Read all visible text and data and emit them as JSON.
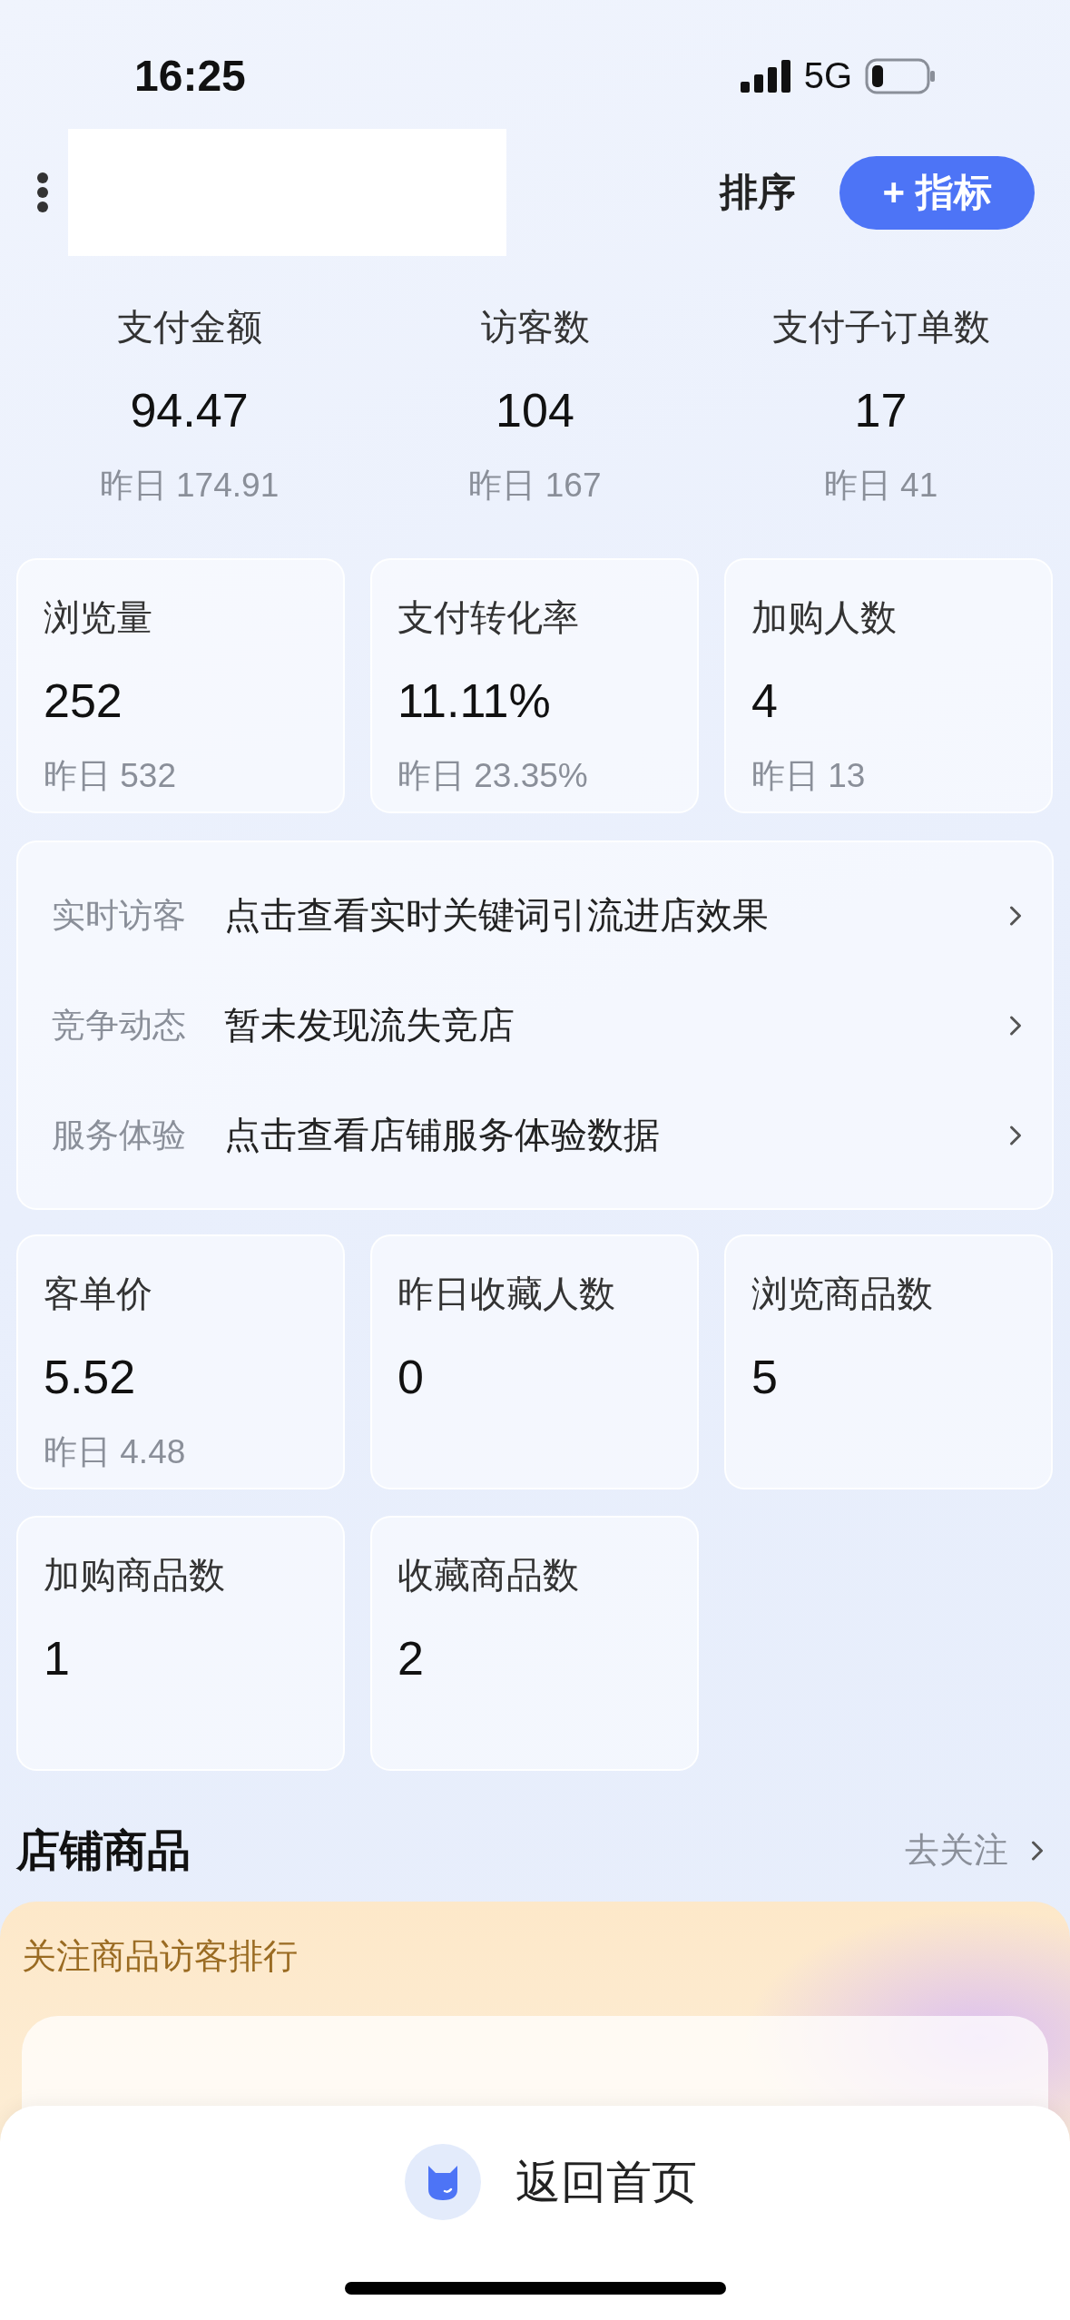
{
  "status_bar": {
    "time": "16:25",
    "network": "5G"
  },
  "header": {
    "sort_label": "排序",
    "add_button": "+ 指标"
  },
  "summary": [
    {
      "label": "支付金额",
      "value": "94.47",
      "yesterday": "昨日 174.91"
    },
    {
      "label": "访客数",
      "value": "104",
      "yesterday": "昨日 167"
    },
    {
      "label": "支付子订单数",
      "value": "17",
      "yesterday": "昨日 41"
    }
  ],
  "metric_cards_top": [
    {
      "label": "浏览量",
      "value": "252",
      "yesterday": "昨日 532"
    },
    {
      "label": "支付转化率",
      "value": "11.11%",
      "yesterday": "昨日 23.35%"
    },
    {
      "label": "加购人数",
      "value": "4",
      "yesterday": "昨日 13"
    }
  ],
  "insights": [
    {
      "label": "实时访客",
      "text": "点击查看实时关键词引流进店效果"
    },
    {
      "label": "竞争动态",
      "text": "暂未发现流失竞店"
    },
    {
      "label": "服务体验",
      "text": "点击查看店铺服务体验数据"
    }
  ],
  "metric_cards_bottom": [
    {
      "label": "客单价",
      "value": "5.52",
      "yesterday": "昨日 4.48"
    },
    {
      "label": "昨日收藏人数",
      "value": "0"
    },
    {
      "label": "浏览商品数",
      "value": "5"
    },
    {
      "label": "加购商品数",
      "value": "1"
    },
    {
      "label": "收藏商品数",
      "value": "2"
    }
  ],
  "store_goods": {
    "title": "店铺商品",
    "link": "去关注",
    "panel_title": "关注商品访客排行"
  },
  "bottom_bar": {
    "label": "返回首页"
  }
}
